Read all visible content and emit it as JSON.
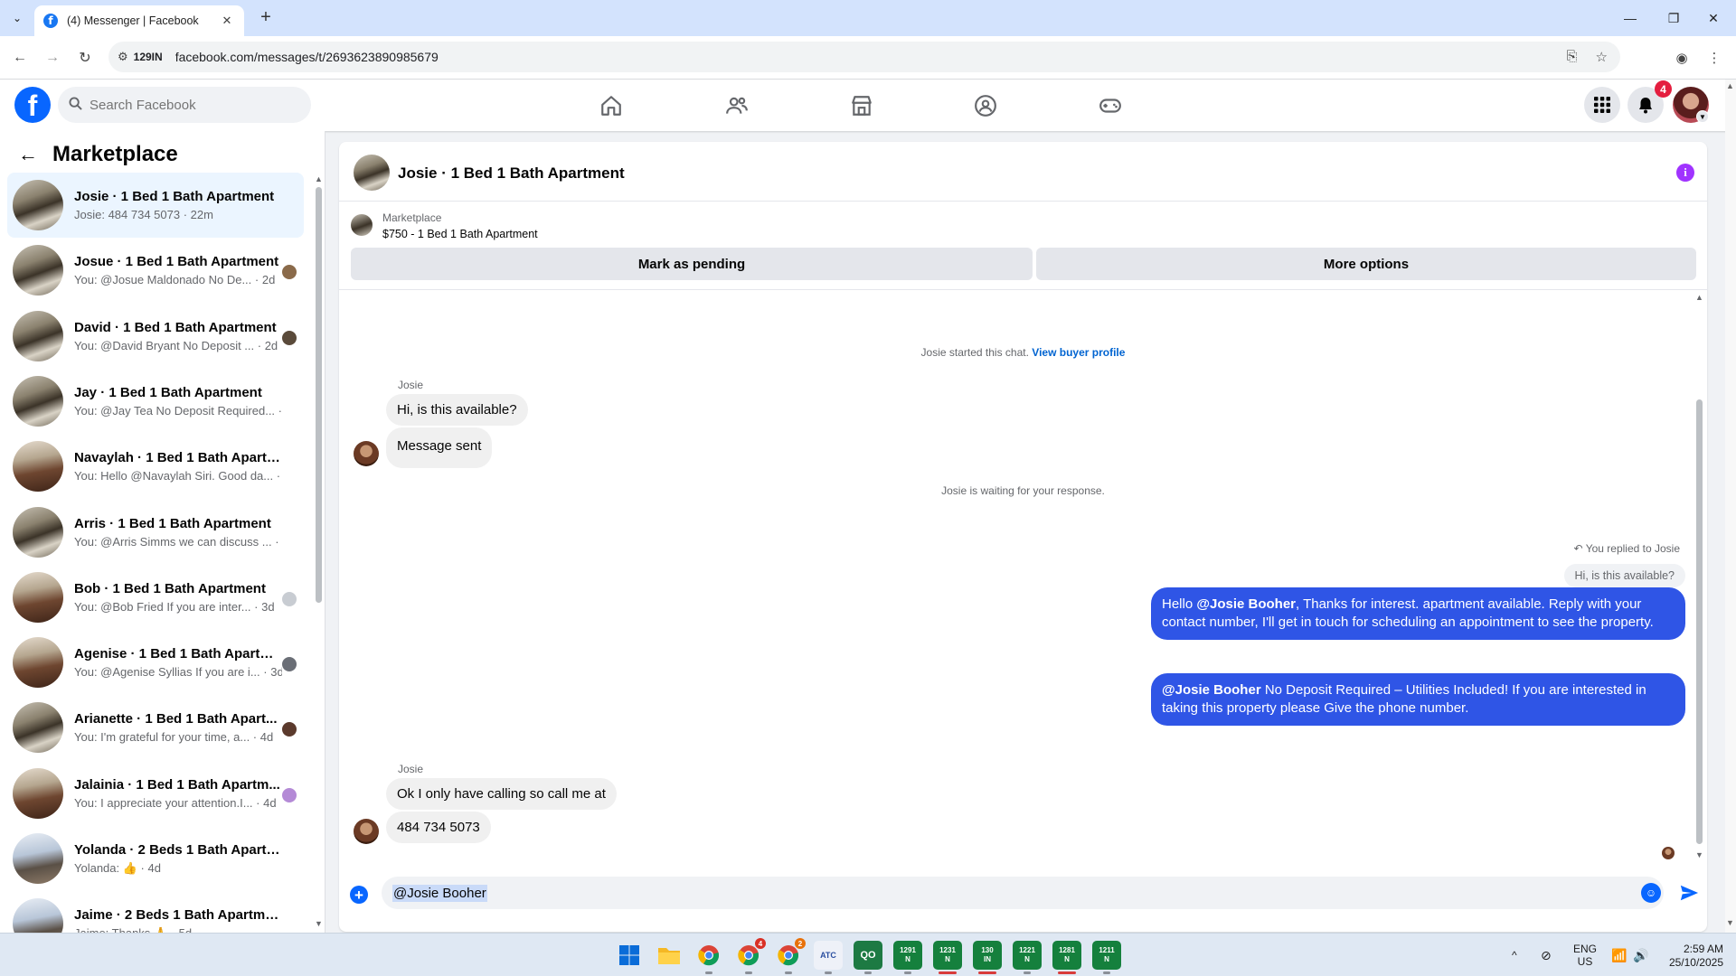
{
  "browser": {
    "tab_title": "(4) Messenger | Facebook",
    "new_tab_icon": "plus-icon",
    "url_chip": "129IN",
    "url": "facebook.com/messages/t/2693623890985679"
  },
  "header": {
    "search_placeholder": "Search Facebook",
    "nav": [
      "home-icon",
      "friends-icon",
      "marketplace-icon",
      "groups-icon",
      "gaming-icon"
    ],
    "notification_count": "4"
  },
  "sidebar": {
    "title": "Marketplace",
    "conversations": [
      {
        "name": "Josie · 1 Bed 1 Bath Apartment",
        "preview": "Josie: 484 734 5073 · 22m",
        "avatar": "k",
        "seen": "",
        "active": true
      },
      {
        "name": "Josue · 1 Bed 1 Bath Apartment",
        "preview": "You: @Josue Maldonado No De... · 2d",
        "avatar": "k",
        "seen": "#8a6a4a"
      },
      {
        "name": "David · 1 Bed 1 Bath Apartment",
        "preview": "You: @David Bryant No Deposit ... · 2d",
        "avatar": "k",
        "seen": "#5a4a3a"
      },
      {
        "name": "Jay · 1 Bed 1 Bath Apartment",
        "preview": "You: @Jay Tea No Deposit Required... · 2d",
        "avatar": "k",
        "seen": ""
      },
      {
        "name": "Navaylah · 1 Bed 1 Bath Apartme...",
        "preview": "You: Hello @Navaylah Siri. Good da... · 3d",
        "avatar": "b",
        "seen": ""
      },
      {
        "name": "Arris · 1 Bed 1 Bath Apartment",
        "preview": "You: @Arris Simms we can discuss ... · 3d",
        "avatar": "k",
        "seen": ""
      },
      {
        "name": "Bob · 1 Bed 1 Bath Apartment",
        "preview": "You: @Bob Fried If you are inter... · 3d",
        "avatar": "b",
        "seen": "#c8ccd2"
      },
      {
        "name": "Agenise · 1 Bed 1 Bath Apartm...",
        "preview": "You: @Agenise Syllias If you are i... · 3d",
        "avatar": "b",
        "seen": "#6a6e76"
      },
      {
        "name": "Arianette · 1 Bed 1 Bath Apart...",
        "preview": "You: I'm grateful for your time, a... · 4d",
        "avatar": "k",
        "seen": "#5b3a2c"
      },
      {
        "name": "Jalainia · 1 Bed 1 Bath Apartm...",
        "preview": "You: I appreciate your attention.I... · 4d",
        "avatar": "b",
        "seen": "#b48ad6"
      },
      {
        "name": "Yolanda · 2 Beds 1 Bath Apartme...",
        "preview": "Yolanda: 👍 · 4d",
        "avatar": "w",
        "seen": ""
      },
      {
        "name": "Jaime · 2 Beds 1 Bath Apartment",
        "preview": "Jaime: Thanks 🙏 · 5d",
        "avatar": "w",
        "seen": ""
      }
    ]
  },
  "chat": {
    "title": "Josie · 1 Bed 1 Bath Apartment",
    "marketplace_label": "Marketplace",
    "listing": "$750 - 1 Bed 1 Bath Apartment",
    "mark_pending": "Mark as pending",
    "more_options": "More options",
    "started_text": "Josie started this chat.",
    "view_profile": "View buyer profile",
    "sender1": "Josie",
    "msg1": "Hi, is this available?",
    "msg2": "Message sent",
    "waiting_text": "Josie is waiting for your response.",
    "replied_note": "You replied to Josie",
    "reply_quote": "Hi, is this available?",
    "out1_mention": "@Josie Booher",
    "out1_pre": "Hello ",
    "out1_post": ", Thanks for interest. apartment available. Reply with your contact number, I'll get in touch for scheduling an appointment to see the property.",
    "out2_mention": "@Josie Booher",
    "out2_post": " No Deposit Required – Utilities Included! If you are interested in taking this property please Give the phone number.",
    "sender2": "Josie",
    "msg3": "Ok I only have calling so call me at",
    "msg4": "484 734 5073",
    "composer_text": "@Josie Booher"
  },
  "taskbar": {
    "lang": "ENG",
    "region": "US",
    "time": "2:59 AM",
    "date": "25/10/2025",
    "chrome_badge1": "4",
    "chrome_badge2": "2",
    "app_labels": [
      "1291\nN",
      "1231\nN",
      "130\nIN",
      "1221\nN",
      "1281\nN",
      "1211\nN"
    ]
  }
}
